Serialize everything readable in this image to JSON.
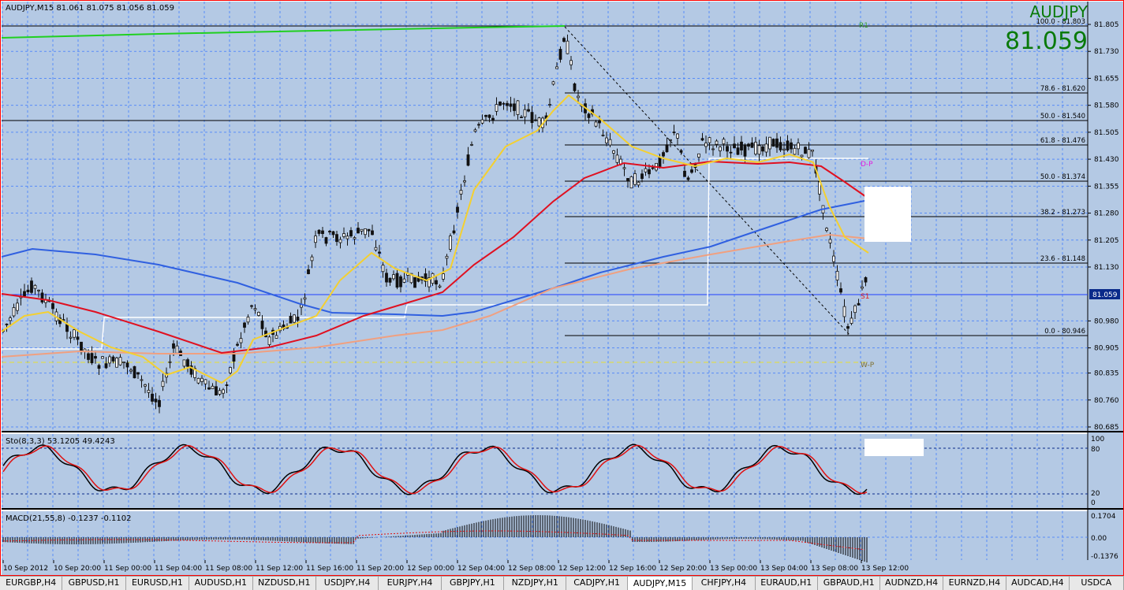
{
  "main_panel": {
    "header": "AUDJPY,M15  81.061 81.075 81.056 81.059",
    "symbol": "AUDJPY",
    "price": "81.059",
    "current_price_tag": "81.059",
    "price_axis": [
      "81.805",
      "81.730",
      "81.655",
      "81.580",
      "81.505",
      "81.430",
      "81.355",
      "81.280",
      "81.205",
      "81.130",
      "81.059",
      "80.980",
      "80.905",
      "80.835",
      "80.760",
      "80.685"
    ],
    "fibo_levels": [
      "100.0 - 81.803",
      "78.6 - 81.620",
      "50.0 - 81.540",
      "61.8 - 81.476",
      "50.0 - 81.374",
      "38.2 - 81.273",
      "23.6 - 81.148",
      "0.0 - 80.946"
    ],
    "pivot_labels": {
      "r1": "R1",
      "dp": "D-P",
      "s1": "S1",
      "wp": "W-P"
    }
  },
  "stoch_panel": {
    "header": "Sto(8,3,3) 53.1205 49.4243",
    "axis": [
      "100",
      "80",
      "20",
      "0"
    ]
  },
  "macd_panel": {
    "header": "MACD(21,55,8) -0.1237 -0.1102",
    "axis": [
      "0.1704",
      "0.00",
      "-0.1376"
    ]
  },
  "time_axis": [
    "10 Sep 2012",
    "10 Sep 20:00",
    "11 Sep 00:00",
    "11 Sep 04:00",
    "11 Sep 08:00",
    "11 Sep 12:00",
    "11 Sep 16:00",
    "11 Sep 20:00",
    "12 Sep 00:00",
    "12 Sep 04:00",
    "12 Sep 08:00",
    "12 Sep 12:00",
    "12 Sep 16:00",
    "12 Sep 20:00",
    "13 Sep 00:00",
    "13 Sep 04:00",
    "13 Sep 08:00",
    "13 Sep 12:00"
  ],
  "tabs": [
    {
      "label": "EURGBP,H4",
      "active": false
    },
    {
      "label": "GBPUSD,H1",
      "active": false
    },
    {
      "label": "EURUSD,H1",
      "active": false
    },
    {
      "label": "AUDUSD,H1",
      "active": false
    },
    {
      "label": "NZDUSD,H1",
      "active": false
    },
    {
      "label": "USDJPY,H4",
      "active": false
    },
    {
      "label": "EURJPY,H4",
      "active": false
    },
    {
      "label": "GBPJPY,H1",
      "active": false
    },
    {
      "label": "NZDJPY,H1",
      "active": false
    },
    {
      "label": "CADJPY,H1",
      "active": false
    },
    {
      "label": "AUDJPY,M15",
      "active": true
    },
    {
      "label": "CHFJPY,H4",
      "active": false
    },
    {
      "label": "EURAUD,H1",
      "active": false
    },
    {
      "label": "GBPAUD,H1",
      "active": false
    },
    {
      "label": "AUDNZD,H4",
      "active": false
    },
    {
      "label": "EURNZD,H4",
      "active": false
    },
    {
      "label": "AUDCAD,H4",
      "active": false
    },
    {
      "label": "USDCA",
      "active": false
    }
  ],
  "colors": {
    "background": "#b4c9e4",
    "grid": "#3b79ff",
    "candle": "#111111",
    "ema_fast": "#f4d030",
    "ema_mid": "#e01020",
    "ema_slow": "#3060e0",
    "ema_salmon": "#f0a080",
    "ma_green": "#20d020",
    "stoch_main": "#000000",
    "stoch_signal": "#e01010",
    "price_tag_bg": "#0a2a8a",
    "symbol_text": "#0a7a0a",
    "frame": "#ff0000"
  }
}
